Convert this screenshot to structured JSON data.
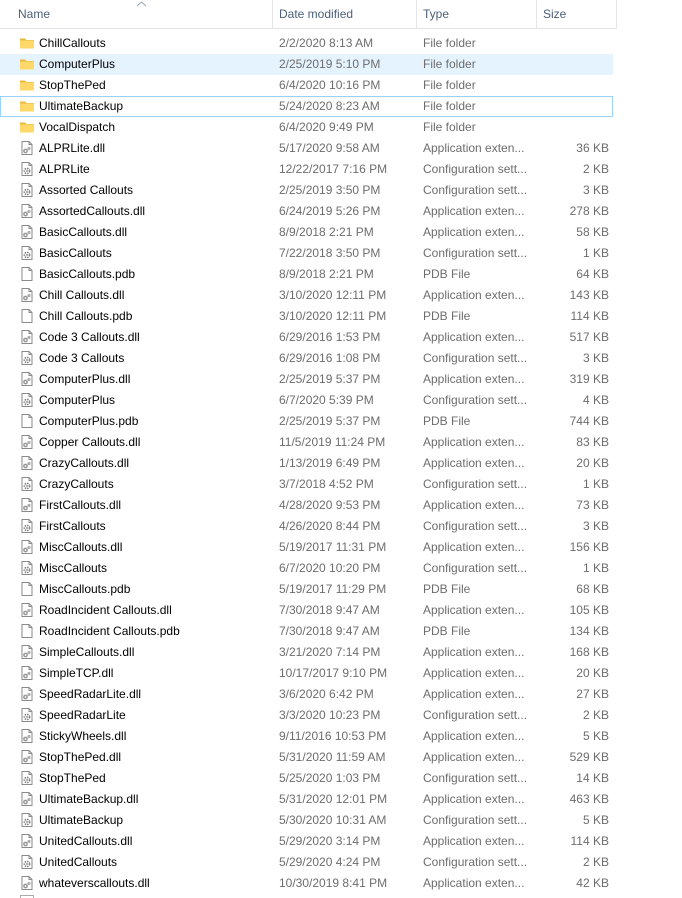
{
  "columns": {
    "name": "Name",
    "date": "Date modified",
    "type": "Type",
    "size": "Size"
  },
  "colors": {
    "header_text": "#4c607a",
    "secondary_text": "#6d6d6d",
    "selection_bg": "#e5f3ff",
    "focus_border": "#99d1ff",
    "folder": "#ffd86a"
  },
  "files": [
    {
      "name": "ChillCallouts",
      "date": "2/2/2020 8:13 AM",
      "type": "File folder",
      "size": "",
      "icon": "folder-icon"
    },
    {
      "name": "ComputerPlus",
      "date": "2/25/2019 5:10 PM",
      "type": "File folder",
      "size": "",
      "icon": "folder-icon",
      "selected": true
    },
    {
      "name": "StopThePed",
      "date": "6/4/2020 10:16 PM",
      "type": "File folder",
      "size": "",
      "icon": "folder-icon"
    },
    {
      "name": "UltimateBackup",
      "date": "5/24/2020 8:23 AM",
      "type": "File folder",
      "size": "",
      "icon": "folder-icon",
      "focused": true
    },
    {
      "name": "VocalDispatch",
      "date": "6/4/2020 9:49 PM",
      "type": "File folder",
      "size": "",
      "icon": "folder-icon"
    },
    {
      "name": "ALPRLite.dll",
      "date": "5/17/2020 9:58 AM",
      "type": "Application exten...",
      "size": "36 KB",
      "icon": "dll-icon"
    },
    {
      "name": "ALPRLite",
      "date": "12/22/2017 7:16 PM",
      "type": "Configuration sett...",
      "size": "2 KB",
      "icon": "config-icon"
    },
    {
      "name": "Assorted Callouts",
      "date": "2/25/2019 3:50 PM",
      "type": "Configuration sett...",
      "size": "3 KB",
      "icon": "config-icon"
    },
    {
      "name": "AssortedCallouts.dll",
      "date": "6/24/2019 5:26 PM",
      "type": "Application exten...",
      "size": "278 KB",
      "icon": "dll-icon"
    },
    {
      "name": "BasicCallouts.dll",
      "date": "8/9/2018 2:21 PM",
      "type": "Application exten...",
      "size": "58 KB",
      "icon": "dll-icon"
    },
    {
      "name": "BasicCallouts",
      "date": "7/22/2018 3:50 PM",
      "type": "Configuration sett...",
      "size": "1 KB",
      "icon": "config-icon"
    },
    {
      "name": "BasicCallouts.pdb",
      "date": "8/9/2018 2:21 PM",
      "type": "PDB File",
      "size": "64 KB",
      "icon": "file-icon"
    },
    {
      "name": "Chill Callouts.dll",
      "date": "3/10/2020 12:11 PM",
      "type": "Application exten...",
      "size": "143 KB",
      "icon": "dll-icon"
    },
    {
      "name": "Chill Callouts.pdb",
      "date": "3/10/2020 12:11 PM",
      "type": "PDB File",
      "size": "114 KB",
      "icon": "file-icon"
    },
    {
      "name": "Code 3 Callouts.dll",
      "date": "6/29/2016 1:53 PM",
      "type": "Application exten...",
      "size": "517 KB",
      "icon": "dll-icon"
    },
    {
      "name": "Code 3 Callouts",
      "date": "6/29/2016 1:08 PM",
      "type": "Configuration sett...",
      "size": "3 KB",
      "icon": "config-icon"
    },
    {
      "name": "ComputerPlus.dll",
      "date": "2/25/2019 5:37 PM",
      "type": "Application exten...",
      "size": "319 KB",
      "icon": "dll-icon"
    },
    {
      "name": "ComputerPlus",
      "date": "6/7/2020 5:39 PM",
      "type": "Configuration sett...",
      "size": "4 KB",
      "icon": "config-icon"
    },
    {
      "name": "ComputerPlus.pdb",
      "date": "2/25/2019 5:37 PM",
      "type": "PDB File",
      "size": "744 KB",
      "icon": "file-icon"
    },
    {
      "name": "Copper Callouts.dll",
      "date": "11/5/2019 11:24 PM",
      "type": "Application exten...",
      "size": "83 KB",
      "icon": "dll-icon"
    },
    {
      "name": "CrazyCallouts.dll",
      "date": "1/13/2019 6:49 PM",
      "type": "Application exten...",
      "size": "20 KB",
      "icon": "dll-icon"
    },
    {
      "name": "CrazyCallouts",
      "date": "3/7/2018 4:52 PM",
      "type": "Configuration sett...",
      "size": "1 KB",
      "icon": "config-icon"
    },
    {
      "name": "FirstCallouts.dll",
      "date": "4/28/2020 9:53 PM",
      "type": "Application exten...",
      "size": "73 KB",
      "icon": "dll-icon"
    },
    {
      "name": "FirstCallouts",
      "date": "4/26/2020 8:44 PM",
      "type": "Configuration sett...",
      "size": "3 KB",
      "icon": "config-icon"
    },
    {
      "name": "MiscCallouts.dll",
      "date": "5/19/2017 11:31 PM",
      "type": "Application exten...",
      "size": "156 KB",
      "icon": "dll-icon"
    },
    {
      "name": "MiscCallouts",
      "date": "6/7/2020 10:20 PM",
      "type": "Configuration sett...",
      "size": "1 KB",
      "icon": "config-icon"
    },
    {
      "name": "MiscCallouts.pdb",
      "date": "5/19/2017 11:29 PM",
      "type": "PDB File",
      "size": "68 KB",
      "icon": "file-icon"
    },
    {
      "name": "RoadIncident Callouts.dll",
      "date": "7/30/2018 9:47 AM",
      "type": "Application exten...",
      "size": "105 KB",
      "icon": "dll-icon"
    },
    {
      "name": "RoadIncident Callouts.pdb",
      "date": "7/30/2018 9:47 AM",
      "type": "PDB File",
      "size": "134 KB",
      "icon": "file-icon"
    },
    {
      "name": "SimpleCallouts.dll",
      "date": "3/21/2020 7:14 PM",
      "type": "Application exten...",
      "size": "168 KB",
      "icon": "dll-icon"
    },
    {
      "name": "SimpleTCP.dll",
      "date": "10/17/2017 9:10 PM",
      "type": "Application exten...",
      "size": "20 KB",
      "icon": "dll-icon"
    },
    {
      "name": "SpeedRadarLite.dll",
      "date": "3/6/2020 6:42 PM",
      "type": "Application exten...",
      "size": "27 KB",
      "icon": "dll-icon"
    },
    {
      "name": "SpeedRadarLite",
      "date": "3/3/2020 10:23 PM",
      "type": "Configuration sett...",
      "size": "2 KB",
      "icon": "config-icon"
    },
    {
      "name": "StickyWheels.dll",
      "date": "9/11/2016 10:53 PM",
      "type": "Application exten...",
      "size": "5 KB",
      "icon": "dll-icon"
    },
    {
      "name": "StopThePed.dll",
      "date": "5/31/2020 11:59 AM",
      "type": "Application exten...",
      "size": "529 KB",
      "icon": "dll-icon"
    },
    {
      "name": "StopThePed",
      "date": "5/25/2020 1:03 PM",
      "type": "Configuration sett...",
      "size": "14 KB",
      "icon": "config-icon"
    },
    {
      "name": "UltimateBackup.dll",
      "date": "5/31/2020 12:01 PM",
      "type": "Application exten...",
      "size": "463 KB",
      "icon": "dll-icon"
    },
    {
      "name": "UltimateBackup",
      "date": "5/30/2020 10:31 AM",
      "type": "Configuration sett...",
      "size": "5 KB",
      "icon": "config-icon"
    },
    {
      "name": "UnitedCallouts.dll",
      "date": "5/29/2020 3:14 PM",
      "type": "Application exten...",
      "size": "114 KB",
      "icon": "dll-icon"
    },
    {
      "name": "UnitedCallouts",
      "date": "5/29/2020 4:24 PM",
      "type": "Configuration sett...",
      "size": "2 KB",
      "icon": "config-icon"
    },
    {
      "name": "whateverscallouts.dll",
      "date": "10/30/2019 8:41 PM",
      "type": "Application exten...",
      "size": "42 KB",
      "icon": "dll-icon"
    }
  ]
}
